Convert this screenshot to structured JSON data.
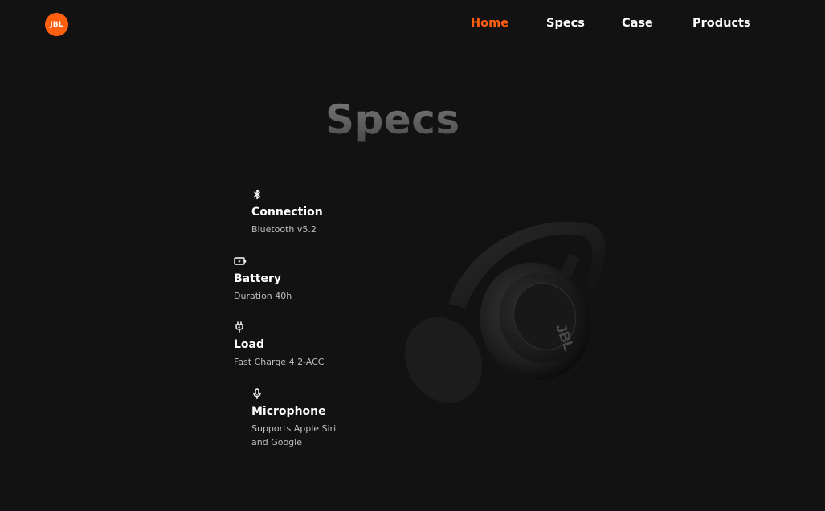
{
  "header": {
    "logo_text": "JBL",
    "brand_color": "#ff5f0f",
    "nav": [
      {
        "label": "Home",
        "active": true
      },
      {
        "label": "Specs",
        "active": false
      },
      {
        "label": "Case",
        "active": false
      },
      {
        "label": "Products",
        "active": false
      }
    ]
  },
  "main": {
    "title": "Specs",
    "specs": [
      {
        "icon": "bluetooth-icon",
        "title": "Connection",
        "desc": "Bluetooth v5.2"
      },
      {
        "icon": "battery-icon",
        "title": "Battery",
        "desc": "Duration 40h"
      },
      {
        "icon": "plug-icon",
        "title": "Load",
        "desc": "Fast Charge 4.2-ACC"
      },
      {
        "icon": "microphone-icon",
        "title": "Microphone",
        "desc": "Supports Apple Siri and Google"
      }
    ],
    "product_image": {
      "brand_mark": "JBL"
    }
  }
}
